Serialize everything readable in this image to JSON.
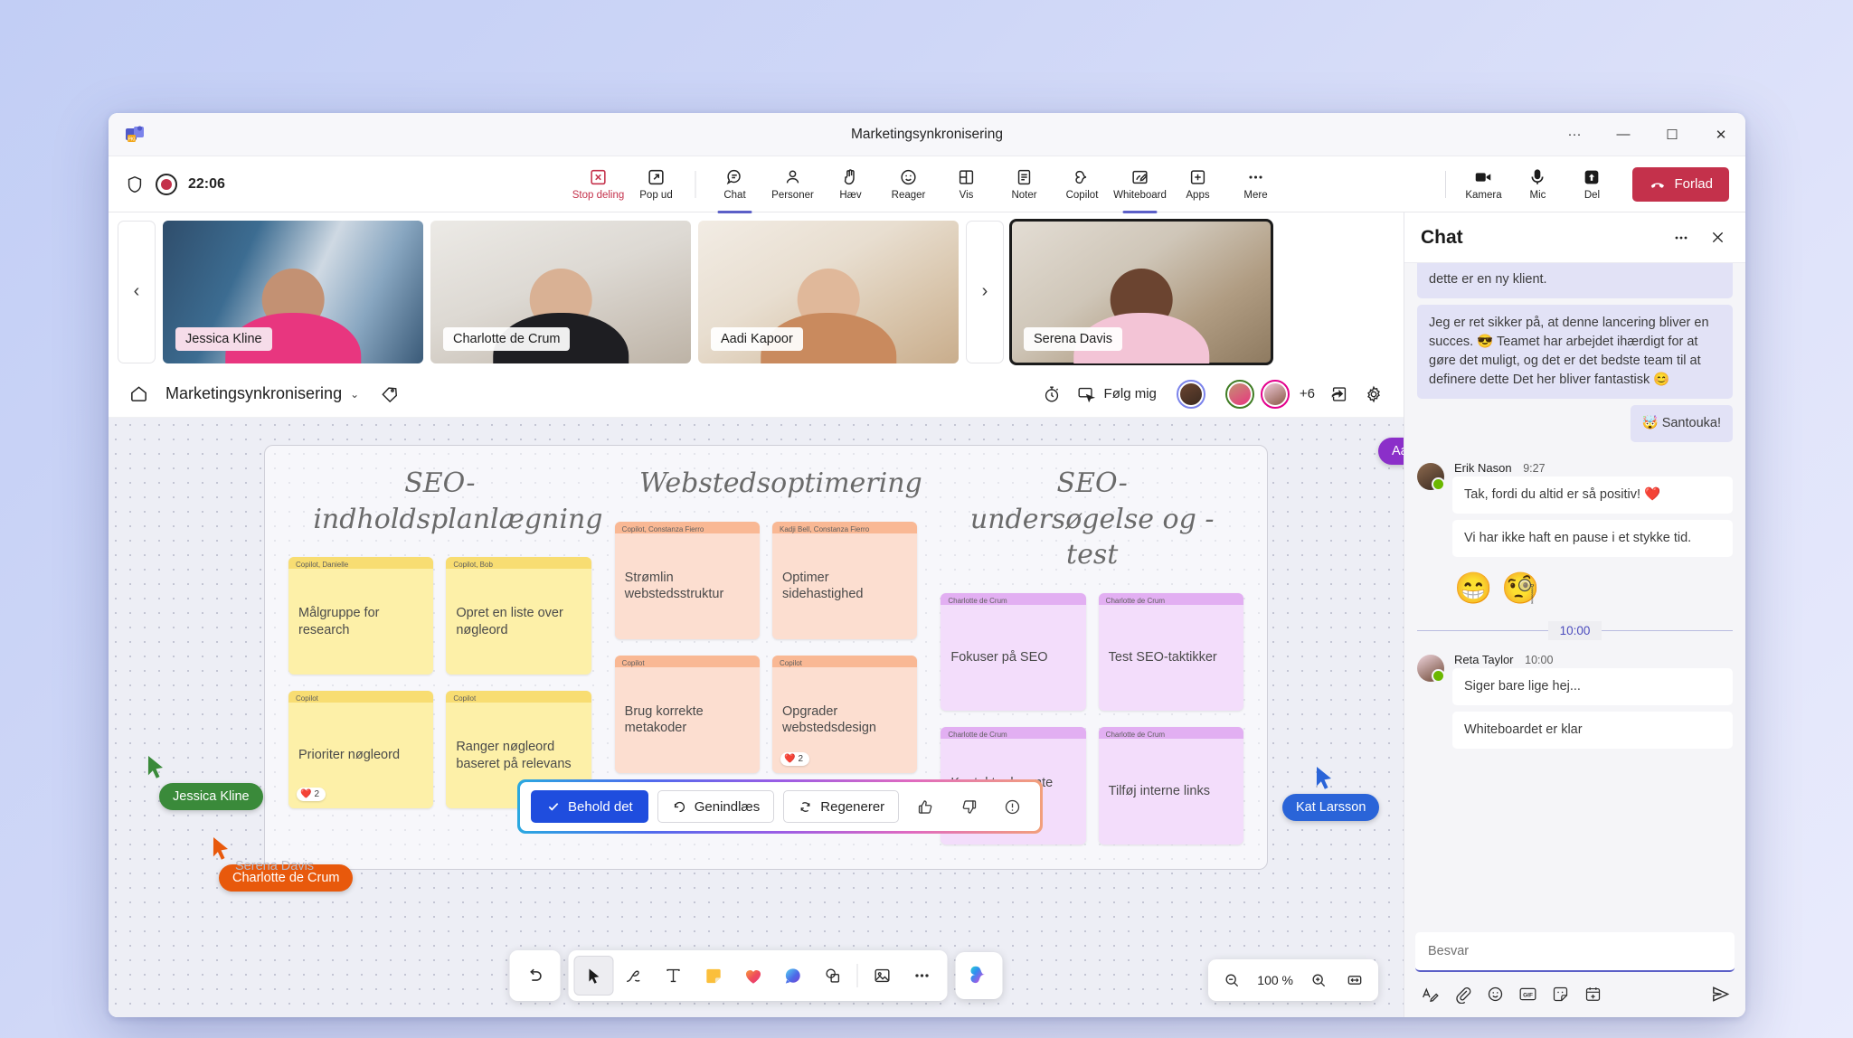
{
  "window": {
    "title": "Marketingsynkronisering",
    "controls": {
      "more": "···",
      "minimize": "—",
      "maximize": "☐",
      "close": "✕"
    }
  },
  "meeting_bar": {
    "recording_time": "22:06",
    "items": [
      {
        "label": "Stop deling",
        "icon": "stop-sharing-icon",
        "danger": true
      },
      {
        "label": "Pop ud",
        "icon": "pop-out-icon"
      },
      {
        "label": "Chat",
        "icon": "chat-icon",
        "active": true
      },
      {
        "label": "Personer",
        "icon": "people-icon"
      },
      {
        "label": "Hæv",
        "icon": "raise-hand-icon"
      },
      {
        "label": "Reager",
        "icon": "react-icon"
      },
      {
        "label": "Vis",
        "icon": "view-icon"
      },
      {
        "label": "Noter",
        "icon": "notes-icon"
      },
      {
        "label": "Copilot",
        "icon": "copilot-icon"
      },
      {
        "label": "Whiteboard",
        "icon": "whiteboard-icon",
        "active": true
      },
      {
        "label": "Apps",
        "icon": "apps-icon"
      },
      {
        "label": "Mere",
        "icon": "more-icon"
      }
    ],
    "devices": [
      {
        "label": "Kamera",
        "icon": "camera-icon"
      },
      {
        "label": "Mic",
        "icon": "microphone-icon"
      },
      {
        "label": "Del",
        "icon": "share-icon"
      }
    ],
    "leave_label": "Forlad"
  },
  "video_strip": {
    "prev_label": "‹",
    "next_label": "›",
    "tiles": [
      {
        "name": "Jessica Kline",
        "active": false
      },
      {
        "name": "Charlotte de Crum",
        "active": false
      },
      {
        "name": "Aadi Kapoor",
        "active": false
      },
      {
        "name": "Serena Davis",
        "active": true
      }
    ]
  },
  "whiteboard_header": {
    "home_icon": "home-icon",
    "title": "Marketingsynkronisering",
    "chevron": "⌄",
    "tag_icon": "tag-icon",
    "timer_icon": "timer-icon",
    "follow_label": "Følg mig",
    "overflow_count": "+6",
    "share_icon": "share-board-icon",
    "settings_icon": "gear-icon"
  },
  "board": {
    "columns": [
      {
        "title": "SEO-indholdsplanlægning",
        "color": "yellow",
        "notes": [
          {
            "author": "Copilot, Danielle",
            "text": "Målgruppe for research",
            "reactions": null
          },
          {
            "author": "Copilot, Bob",
            "text": "Opret en liste over nøgleord",
            "reactions": null
          },
          {
            "author": "Copilot",
            "text": "Prioriter nøgleord",
            "reactions": "2"
          },
          {
            "author": "Copilot",
            "text": "Ranger nøgleord baseret på relevans",
            "reactions": null
          }
        ]
      },
      {
        "title": "Webstedsoptimering",
        "color": "orange",
        "notes": [
          {
            "author": "Copilot, Constanza Fierro",
            "text": "Strømlin webstedsstruktur",
            "reactions": null
          },
          {
            "author": "Kadji Bell, Constanza Fierro",
            "text": "Optimer sidehastighed",
            "reactions": null
          },
          {
            "author": "Copilot",
            "text": "Brug korrekte metakoder",
            "reactions": null
          },
          {
            "author": "Copilot",
            "text": "Opgrader webstedsdesign",
            "reactions": "2"
          }
        ]
      },
      {
        "title": "SEO-undersøgelse og -test",
        "color": "purple",
        "notes": [
          {
            "author": "Charlotte de Crum",
            "text": "Fokuser på SEO",
            "reactions": null
          },
          {
            "author": "Charlotte de Crum",
            "text": "Test SEO-taktikker",
            "reactions": null
          },
          {
            "author": "Charlotte de Crum",
            "text": "Kontakt relevante websteder",
            "reactions": null
          },
          {
            "author": "Charlotte de Crum",
            "text": "Tilføj interne links",
            "reactions": null
          }
        ]
      }
    ],
    "cursors": [
      {
        "name": "Aadi Kapoor",
        "color": "#8b2fc9"
      },
      {
        "name": "Jessica Kline",
        "color": "#3a8a3a"
      },
      {
        "name": "Charlotte de Crum",
        "color": "#e8590c"
      },
      {
        "name": "Kat Larsson",
        "color": "#2a64d8"
      }
    ],
    "ghost_label": "Serena Davis"
  },
  "copilot_bar": {
    "keep_label": "Behold det",
    "reload_label": "Genindlæs",
    "regenerate_label": "Regenerer",
    "thumbs_up_icon": "thumbs-up-icon",
    "thumbs_down_icon": "thumbs-down-icon",
    "info_icon": "info-icon"
  },
  "tools": {
    "undo_icon": "undo-icon",
    "items": [
      {
        "icon": "select-pointer-icon",
        "selected": true
      },
      {
        "icon": "pen-icon",
        "selected": false
      },
      {
        "icon": "text-icon",
        "selected": false
      },
      {
        "icon": "sticky-note-icon",
        "selected": false
      },
      {
        "icon": "reaction-heart-icon",
        "selected": false
      },
      {
        "icon": "comment-bubble-icon",
        "selected": false
      },
      {
        "icon": "shapes-icon",
        "selected": false
      },
      {
        "icon": "image-icon",
        "selected": false
      },
      {
        "icon": "more-tools-icon",
        "selected": false
      }
    ],
    "copilot_fab_icon": "copilot-icon"
  },
  "zoom_controls": {
    "zoom_out_icon": "zoom-out-icon",
    "level": "100 %",
    "zoom_in_icon": "zoom-in-icon",
    "fit_icon": "fit-to-screen-icon"
  },
  "chat": {
    "title": "Chat",
    "more_icon": "more-icon",
    "close_icon": "close-icon",
    "messages": [
      {
        "kind": "bubble-cut",
        "side": "me",
        "text": "dette er en ny klient."
      },
      {
        "kind": "bubble",
        "side": "me",
        "text": "Jeg er ret sikker på, at denne lancering bliver en succes. 😎 Teamet har arbejdet ihærdigt for at gøre det muligt, og det er det bedste team til at definere dette Det her bliver fantastisk 😊"
      },
      {
        "kind": "bubble-right",
        "side": "me",
        "text": "🤯 Santouka!"
      },
      {
        "kind": "message",
        "author": "Erik Nason",
        "time": "9:27",
        "text": "Tak, fordi du altid er så positiv! ❤️"
      },
      {
        "kind": "bubble",
        "side": "them",
        "text": "Vi har ikke haft en pause i et stykke tid."
      },
      {
        "kind": "emoji-row",
        "emojis": [
          "😁",
          "🧐"
        ]
      },
      {
        "kind": "divider",
        "label": "10:00"
      },
      {
        "kind": "message",
        "author": "Reta Taylor",
        "time": "10:00",
        "text": "Siger bare lige hej..."
      },
      {
        "kind": "bubble",
        "side": "them",
        "text": "Whiteboardet er klar"
      }
    ],
    "compose_placeholder": "Besvar",
    "compose_actions": [
      {
        "icon": "format-icon"
      },
      {
        "icon": "attach-icon"
      },
      {
        "icon": "emoji-icon"
      },
      {
        "icon": "gif-icon"
      },
      {
        "icon": "sticker-icon"
      },
      {
        "icon": "schedule-icon"
      }
    ],
    "send_icon": "send-icon"
  }
}
